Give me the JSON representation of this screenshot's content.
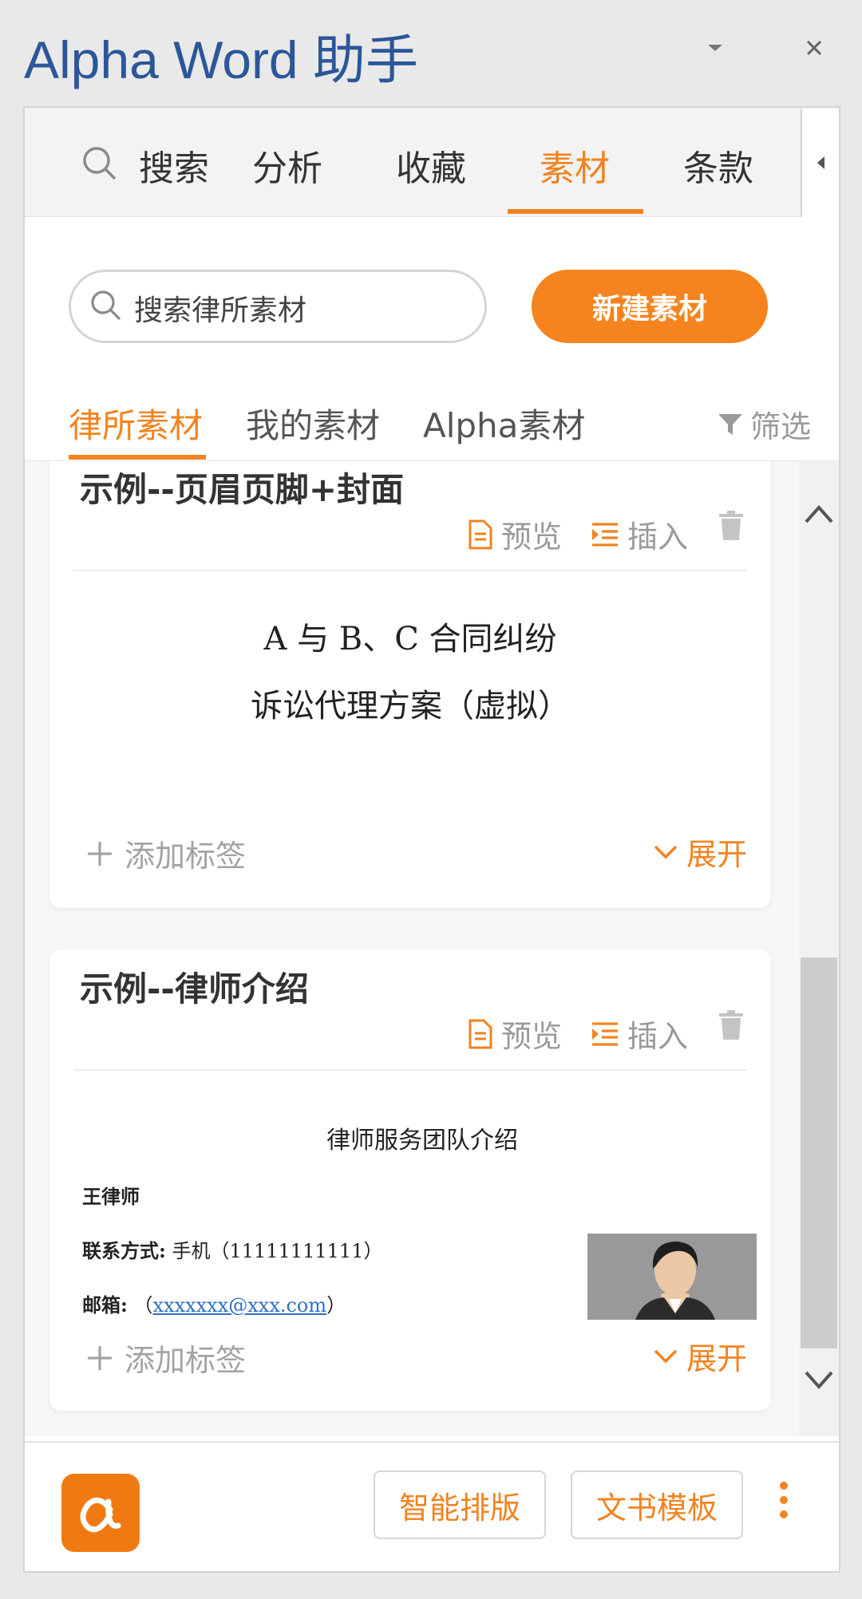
{
  "window": {
    "title": "Alpha Word 助手",
    "minimize_icon": "chevron-down-icon",
    "close_icon": "close-icon"
  },
  "topnav": {
    "search_label": "搜索",
    "tabs": [
      "分析",
      "收藏",
      "素材",
      "条款"
    ],
    "active_tab": "素材"
  },
  "toolbar": {
    "search_placeholder": "搜索律所素材",
    "new_button": "新建素材"
  },
  "subtabs": {
    "items": [
      "律所素材",
      "我的素材",
      "Alpha素材"
    ],
    "active": "律所素材",
    "filter_label": "筛选"
  },
  "cards": [
    {
      "title": "示例--页眉页脚+封面",
      "preview_label": "预览",
      "insert_label": "插入",
      "preview_lines": [
        "A 与 B、C 合同纠纷",
        "诉讼代理方案（虚拟）"
      ],
      "add_tag": "添加标签",
      "expand": "展开"
    },
    {
      "title": "示例--律师介绍",
      "preview_label": "预览",
      "insert_label": "插入",
      "doc_title": "律师服务团队介绍",
      "name_line": "王律师",
      "contact_label": "联系方式:",
      "contact_value": "手机（11111111111）",
      "email_label": "邮箱:",
      "email_open": "（",
      "email_value": "xxxxxxx@xxx.com",
      "email_close": "）",
      "add_tag": "添加标签",
      "expand": "展开"
    }
  ],
  "footer": {
    "btn_smart_layout": "智能排版",
    "btn_doc_template": "文书模板",
    "more_icon": "more-vertical-icon"
  },
  "colors": {
    "accent": "#f28320",
    "title_blue": "#2b579a"
  }
}
